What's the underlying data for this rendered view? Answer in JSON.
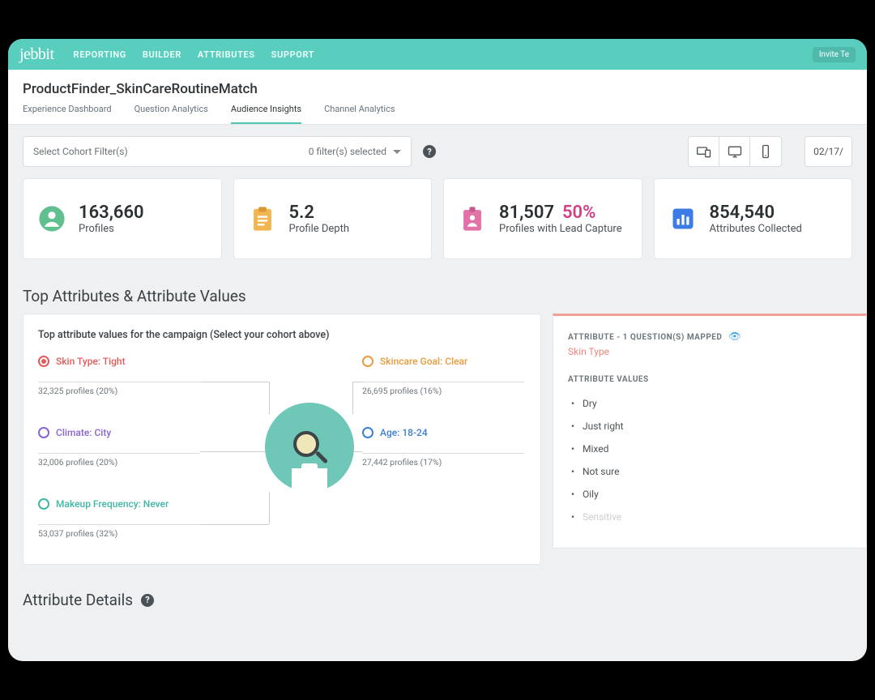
{
  "brand": "jebbit",
  "nav": [
    "REPORTING",
    "BUILDER",
    "ATTRIBUTES",
    "SUPPORT"
  ],
  "invite_label": "Invite Te",
  "page_title": "ProductFinder_SkinCareRoutineMatch",
  "subtabs": [
    "Experience Dashboard",
    "Question Analytics",
    "Audience Insights",
    "Channel Analytics"
  ],
  "active_subtab_index": 2,
  "cohort_filter": {
    "placeholder": "Select Cohort Filter(s)",
    "count_label": "0 filter(s) selected"
  },
  "date_label": "02/17/",
  "cards": {
    "profiles": {
      "value": "163,660",
      "label": "Profiles"
    },
    "depth": {
      "value": "5.2",
      "label": "Profile Depth"
    },
    "lead": {
      "value": "81,507",
      "pct": "50%",
      "label": "Profiles with Lead Capture"
    },
    "attrs": {
      "value": "854,540",
      "label": "Attributes Collected"
    }
  },
  "section_top_attrs": "Top Attributes & Attribute Values",
  "attr_panel_title": "Top attribute values for the campaign (Select your cohort above)",
  "top_attrs": {
    "a0": {
      "label": "Skin Type: Tight",
      "sub": "32,325 profiles (20%)"
    },
    "a1": {
      "label": "Skincare Goal: Clear",
      "sub": "26,695 profiles (16%)"
    },
    "a2": {
      "label": "Climate: City",
      "sub": "32,006 profiles (20%)"
    },
    "a3": {
      "label": "Age: 18-24",
      "sub": "27,442 profiles (17%)"
    },
    "a4": {
      "label": "Makeup Frequency: Never",
      "sub": "53,037 profiles (32%)"
    }
  },
  "attr_side": {
    "header": "ATTRIBUTE - 1 QUESTION(S) MAPPED",
    "name": "Skin Type",
    "values_header": "ATTRIBUTE VALUES",
    "values": [
      "Dry",
      "Just right",
      "Mixed",
      "Not sure",
      "Oily",
      "Sensitive"
    ]
  },
  "section_attr_details": "Attribute Details"
}
